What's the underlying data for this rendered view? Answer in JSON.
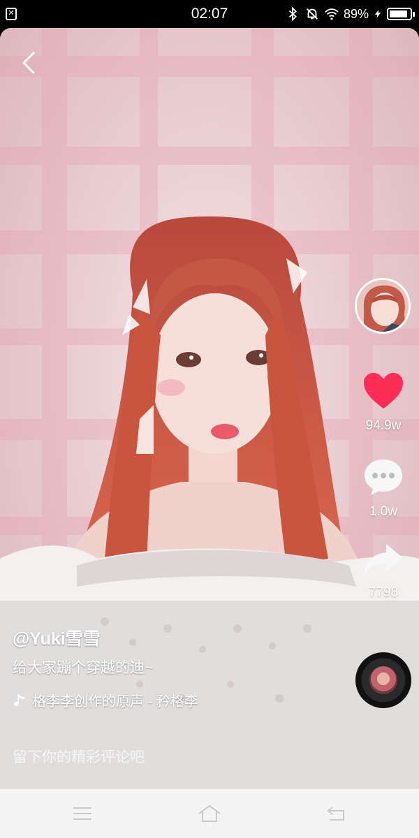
{
  "status_bar": {
    "time": "02:07",
    "battery": "89%",
    "battery_level": 0.89,
    "icons": [
      "notification-app-icon",
      "bluetooth-icon",
      "mute-icon",
      "wifi-icon",
      "charging-icon",
      "battery-icon"
    ]
  },
  "video": {
    "author_handle": "@Yuki雪雪",
    "description": "给大家蹦个穿越的迪~",
    "music": "格李李创作的原声 - 矜格李",
    "comment_placeholder": "留下你的精彩评论吧"
  },
  "actions": {
    "likes": "94.9w",
    "comments": "1.0w",
    "shares": "7798"
  },
  "colors": {
    "like": "#fe2c55",
    "background": "#f2d9dc"
  },
  "nav_bar": {
    "icons": [
      "menu-icon",
      "home-icon",
      "back-icon"
    ]
  }
}
